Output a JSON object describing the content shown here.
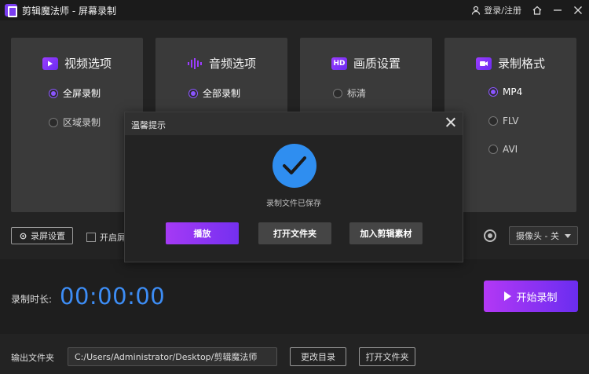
{
  "app": {
    "title": "剪辑魔法师 - 屏幕录制"
  },
  "titlebar": {
    "login_label": "登录/注册",
    "icons": [
      "user-icon",
      "home-icon",
      "minimize-icon",
      "close-icon"
    ]
  },
  "cards": [
    {
      "title": "视频选项",
      "icon": "video-icon",
      "options": [
        {
          "label": "全屏录制",
          "selected": true
        },
        {
          "label": "区域录制",
          "selected": false
        }
      ]
    },
    {
      "title": "音频选项",
      "icon": "audio-icon",
      "options": [
        {
          "label": "全部录制",
          "selected": true
        }
      ]
    },
    {
      "title": "画质设置",
      "icon_text": "HD",
      "options": [
        {
          "label": "标清",
          "selected": false
        }
      ]
    },
    {
      "title": "录制格式",
      "icon": "camera-format-icon",
      "options": [
        {
          "label": "MP4",
          "selected": true
        },
        {
          "label": "FLV",
          "selected": false
        },
        {
          "label": "AVI",
          "selected": false
        }
      ]
    }
  ],
  "toolbar": {
    "settings_label": "录屏设置",
    "checkbox_label": "开启屏",
    "camera_select": "摄像头 - 关"
  },
  "timer": {
    "label": "录制时长:",
    "value": "00:00:00",
    "start_label": "开始录制"
  },
  "output": {
    "label": "输出文件夹",
    "path": "C:/Users/Administrator/Desktop/剪辑魔法师",
    "change_dir_label": "更改目录",
    "open_folder_label": "打开文件夹"
  },
  "modal": {
    "title": "温馨提示",
    "message": "录制文件已保存",
    "play_label": "播放",
    "open_folder_label": "打开文件夹",
    "add_material_label": "加入剪辑素材"
  },
  "colors": {
    "accent": "#8a55ff",
    "timer": "#3d8df5",
    "check": "#2f8ef0"
  }
}
